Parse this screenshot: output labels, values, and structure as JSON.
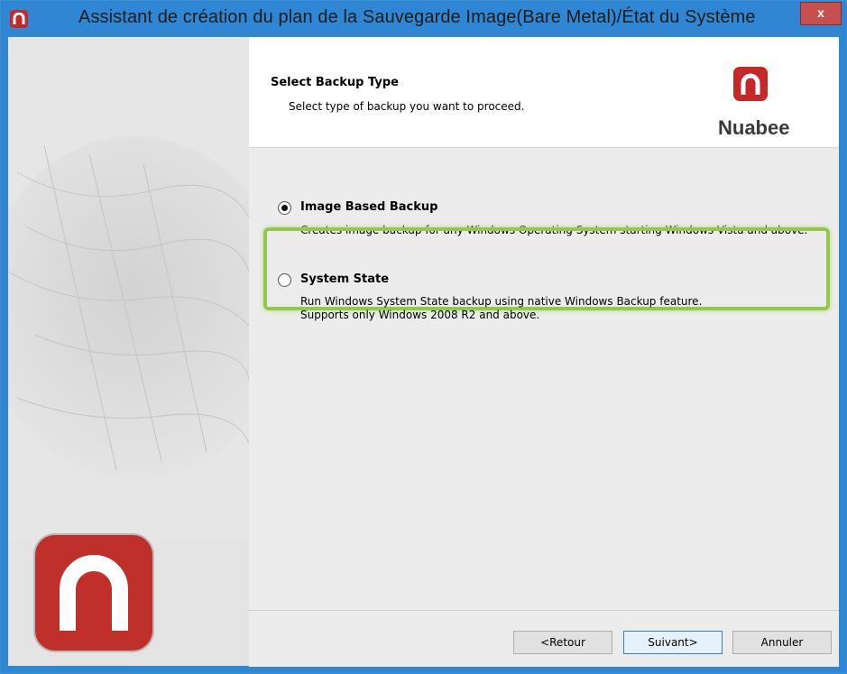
{
  "window": {
    "title": "Assistant de création du plan de la Sauvegarde Image(Bare Metal)/État du Système",
    "close_label": "x"
  },
  "header": {
    "title": "Select Backup Type",
    "subtitle": "Select type of backup you want to proceed.",
    "brand": "Nuabee"
  },
  "options": [
    {
      "label": "Image Based Backup",
      "description": "Creates image backup for any Windows Operating System starting Windows Vista and above.",
      "selected": true
    },
    {
      "label": "System State",
      "description_line1": "Run Windows System State backup using native Windows Backup feature.",
      "description_line2": "Supports only Windows 2008 R2 and above.",
      "selected": false,
      "highlighted": true
    }
  ],
  "buttons": {
    "back": "<Retour",
    "next": "Suivant>",
    "cancel": "Annuler"
  },
  "colors": {
    "title_bar": "#2f86d3",
    "brand_red": "#c62828",
    "highlight": "#93c84a"
  }
}
